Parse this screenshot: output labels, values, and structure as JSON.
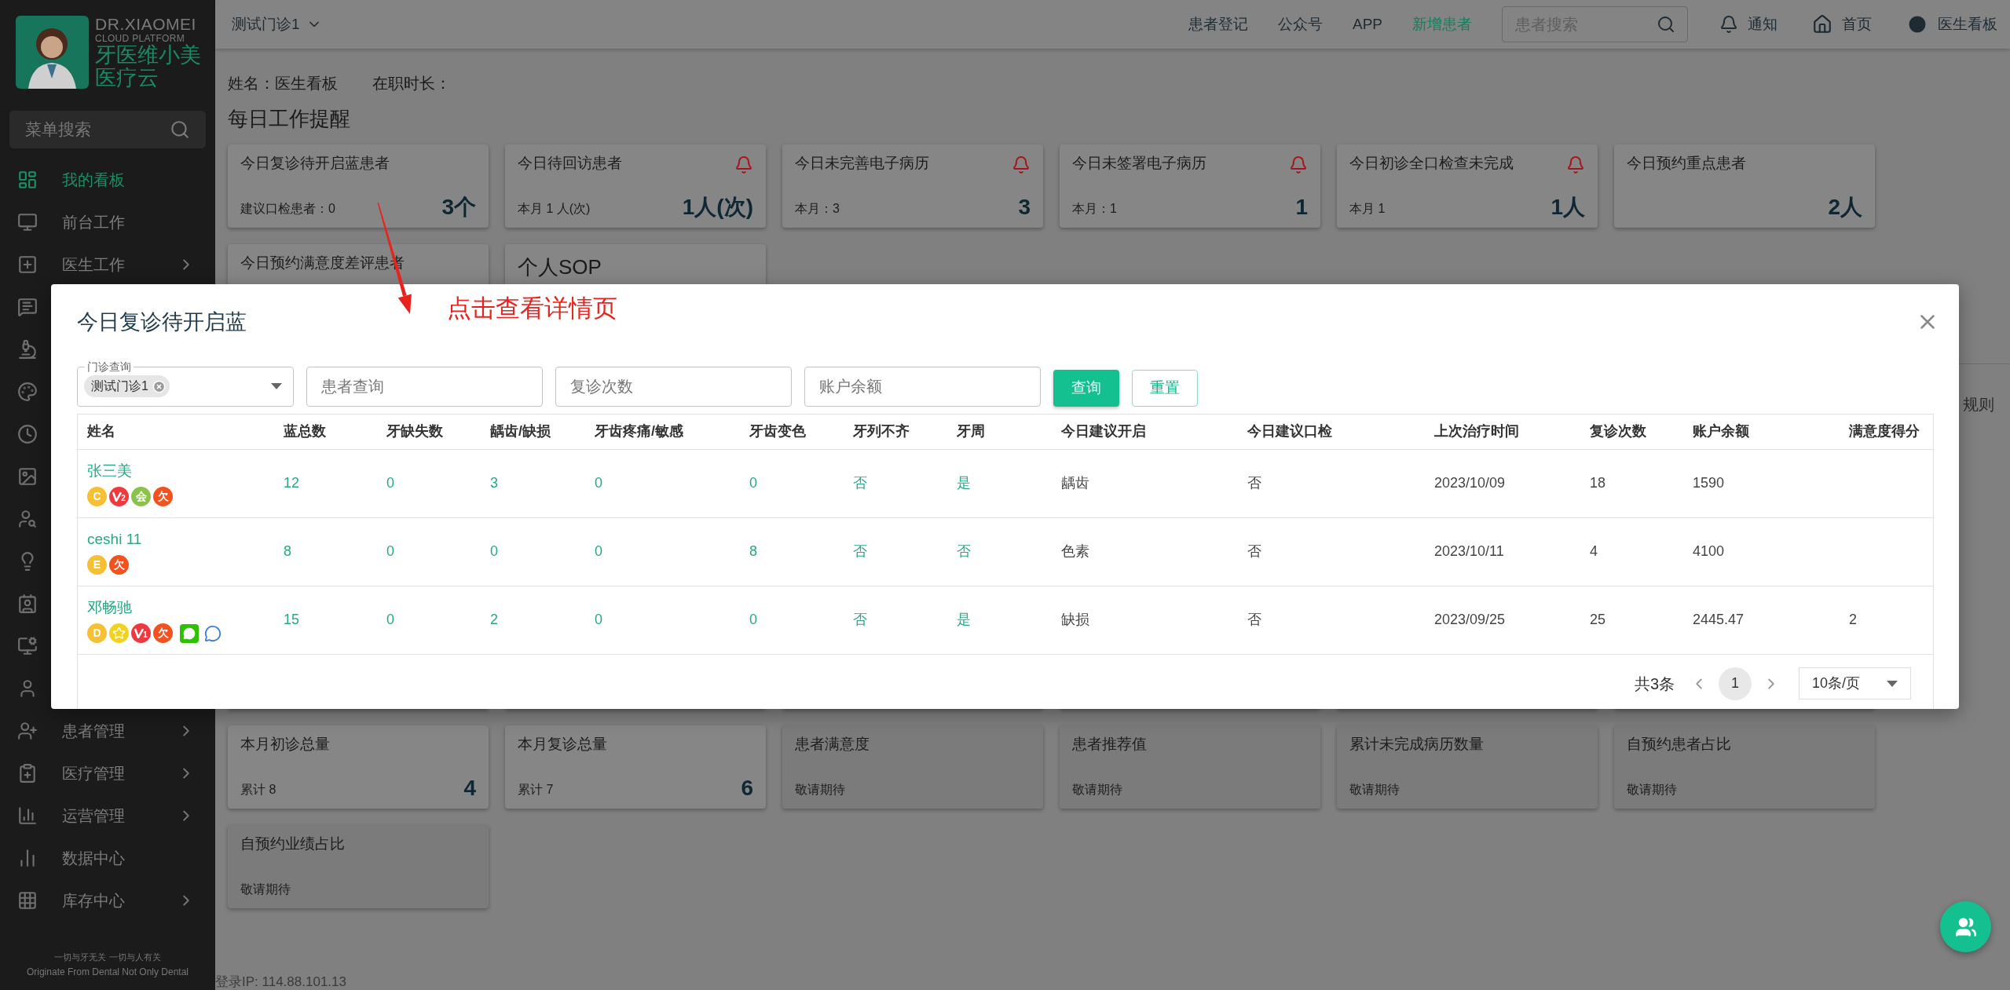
{
  "sidebar": {
    "logo": {
      "line_1": "DR.XIAOMEI",
      "line_2": "CLOUD PLATFORM",
      "line_3": "牙医维小美",
      "line_4": "医疗云"
    },
    "search": {
      "placeholder": "菜单搜索"
    },
    "items": [
      {
        "label": "我的看板",
        "selected": true,
        "has_submenu": false
      },
      {
        "label": "前台工作",
        "selected": false,
        "has_submenu": false
      },
      {
        "label": "医生工作",
        "selected": false,
        "has_submenu": true
      },
      {
        "selected": false
      },
      {
        "selected": false
      },
      {
        "selected": false
      },
      {
        "selected": false
      },
      {
        "selected": false
      },
      {
        "selected": false
      },
      {
        "selected": false
      },
      {
        "selected": false
      },
      {
        "selected": false
      },
      {
        "selected": false
      },
      {
        "label": "患者管理",
        "selected": false,
        "has_submenu": true
      },
      {
        "label": "医疗管理",
        "selected": false,
        "has_submenu": true
      },
      {
        "label": "运营管理",
        "selected": false,
        "has_submenu": true
      },
      {
        "label": "数据中心",
        "selected": false,
        "has_submenu": false
      },
      {
        "label": "库存中心",
        "selected": false,
        "has_submenu": true
      }
    ],
    "footer": {
      "line_1": "一切与牙无关 一切与人有关",
      "line_2": "Originate From Dental Not Only Dental"
    }
  },
  "header": {
    "clinic": "测试门诊1",
    "links": [
      {
        "label": "患者登记",
        "highlighted": false
      },
      {
        "label": "公众号",
        "highlighted": false
      },
      {
        "label": "APP",
        "highlighted": false
      },
      {
        "label": "新增患者",
        "highlighted": true
      }
    ],
    "search": {
      "placeholder": "患者搜索"
    },
    "actions": [
      {
        "kind": "bell",
        "label": "通知"
      },
      {
        "kind": "home",
        "label": "首页"
      },
      {
        "kind": "account",
        "label": "医生看板"
      }
    ]
  },
  "profile": {
    "name": "姓名：医生看板",
    "tenure": "在职时长："
  },
  "section_title": "每日工作提醒",
  "card_rows": [
    {
      "cards": [
        {
          "kind": "stat",
          "title": "今日复诊待开启蓝患者",
          "alert": false,
          "sub": "建议口检患者：0",
          "value": "3个",
          "disabled": false
        },
        {
          "kind": "stat",
          "title": "今日待回访患者",
          "alert": true,
          "sub": "本月 1 人(次)",
          "value": "1人(次)",
          "disabled": false
        },
        {
          "kind": "stat",
          "title": "今日未完善电子病历",
          "alert": true,
          "sub": "本月：3",
          "value": "3",
          "disabled": false
        },
        {
          "kind": "stat",
          "title": "今日未签署电子病历",
          "alert": true,
          "sub": "本月：1",
          "value": "1",
          "disabled": false
        },
        {
          "kind": "stat",
          "title": "今日初诊全口检查未完成",
          "alert": true,
          "sub": "本月 1",
          "value": "1人",
          "disabled": false
        },
        {
          "kind": "stat",
          "title": "今日预约重点患者",
          "alert": false,
          "value": "2人",
          "disabled": false
        }
      ]
    },
    {
      "cards": [
        {
          "kind": "stat",
          "title": "今日预约满意度差评患者",
          "alert": false,
          "disabled": false
        },
        {
          "kind": "sop",
          "title": "个人SOP"
        }
      ]
    }
  ],
  "hidden_section": {
    "title_fragment": "规则"
  },
  "lower_card_rows": [
    {
      "cards": [
        {
          "kind": "blank"
        },
        {
          "kind": "blank"
        },
        {
          "kind": "blank"
        },
        {
          "kind": "blank"
        },
        {
          "kind": "blank"
        },
        {
          "kind": "blank"
        }
      ]
    },
    {
      "cards": [
        {
          "kind": "stat",
          "title": "本月初诊总量",
          "alert": false,
          "sub": "累计 8",
          "value": "4",
          "disabled": false
        },
        {
          "kind": "stat",
          "title": "本月复诊总量",
          "alert": false,
          "sub": "累计 7",
          "value": "6",
          "disabled": false
        },
        {
          "kind": "stat",
          "title": "患者满意度",
          "alert": false,
          "sub": "敬请期待",
          "disabled": true
        },
        {
          "kind": "stat",
          "title": "患者推荐值",
          "alert": false,
          "sub": "敬请期待",
          "disabled": true
        },
        {
          "kind": "stat",
          "title": "累计未完成病历数量",
          "alert": false,
          "sub": "敬请期待",
          "disabled": true
        },
        {
          "kind": "stat",
          "title": "自预约患者占比",
          "alert": false,
          "sub": "敬请期待",
          "disabled": true
        }
      ]
    },
    {
      "cards": [
        {
          "kind": "stat",
          "title": "自预约业绩占比",
          "alert": false,
          "sub": "敬请期待",
          "disabled": true
        }
      ]
    }
  ],
  "login_ip": "登录IP: 114.88.101.13",
  "annotation": {
    "text": "点击查看详情页"
  },
  "modal": {
    "title": "今日复诊待开启蓝",
    "filters": {
      "clinic": {
        "legend": "门诊查询",
        "chips": [
          "测试门诊1"
        ]
      },
      "fields": [
        {
          "placeholder": "患者查询"
        },
        {
          "placeholder": "复诊次数"
        },
        {
          "placeholder": "账户余额"
        }
      ],
      "buttons": [
        {
          "label": "查询",
          "kind": "primary"
        },
        {
          "label": "重置",
          "kind": "outline"
        }
      ]
    },
    "table": {
      "columns": [
        {
          "label": "姓名",
          "kind": "name"
        },
        {
          "label": "蓝总数",
          "kind": "count"
        },
        {
          "label": "牙缺失数",
          "kind": "count"
        },
        {
          "label": "龋齿/缺损",
          "kind": "count"
        },
        {
          "label": "牙齿疼痛/敏感",
          "kind": "count"
        },
        {
          "label": "牙齿变色",
          "kind": "count"
        },
        {
          "label": "牙列不齐",
          "kind": "count"
        },
        {
          "label": "牙周",
          "kind": "count"
        },
        {
          "label": "今日建议开启",
          "kind": "text"
        },
        {
          "label": "今日建议口检",
          "kind": "text"
        },
        {
          "label": "上次治疗时间",
          "kind": "text"
        },
        {
          "label": "复诊次数",
          "kind": "text"
        },
        {
          "label": "账户余额",
          "kind": "text"
        },
        {
          "label": "满意度得分",
          "kind": "text"
        }
      ],
      "rows": [
        {
          "badges": [
            {
              "kind": "letter",
              "text": "C",
              "color": "#f7c034"
            },
            {
              "kind": "vip",
              "text": "2",
              "color": "#f0383d"
            },
            {
              "kind": "letter",
              "text": "会",
              "color": "#8bc34a"
            },
            {
              "kind": "letter",
              "text": "欠",
              "color": "#f4511e"
            }
          ],
          "cells": [
            "张三美",
            "12",
            "0",
            "3",
            "0",
            "0",
            "否",
            "是",
            "龋齿",
            "否",
            "2023/10/09",
            "18",
            "1590"
          ]
        },
        {
          "badges": [
            {
              "kind": "letter",
              "text": "E",
              "color": "#f7c034"
            },
            {
              "kind": "letter",
              "text": "欠",
              "color": "#f4511e"
            }
          ],
          "cells": [
            "ceshi 11",
            "8",
            "0",
            "0",
            "0",
            "8",
            "否",
            "否",
            "色素",
            "否",
            "2023/10/11",
            "4",
            "4100"
          ]
        },
        {
          "badges": [
            {
              "kind": "letter",
              "text": "D",
              "color": "#f7c034"
            },
            {
              "kind": "star",
              "color": "#f2d21c"
            },
            {
              "kind": "vip",
              "text": "1",
              "color": "#f0383d"
            },
            {
              "kind": "letter",
              "text": "欠",
              "color": "#f4511e"
            },
            {
              "kind": "wechat",
              "color": "#2dc100"
            },
            {
              "kind": "chat",
              "color": "#3b7de0"
            }
          ],
          "cells": [
            "邓畅驰",
            "15",
            "0",
            "2",
            "0",
            "0",
            "否",
            "是",
            "缺损",
            "否",
            "2023/09/25",
            "25",
            "2445.47",
            "2"
          ]
        }
      ]
    },
    "pagination": {
      "total": "共3条",
      "pages": [
        {
          "label": "1",
          "selected": true
        }
      ],
      "page_size": "10条/页"
    }
  }
}
